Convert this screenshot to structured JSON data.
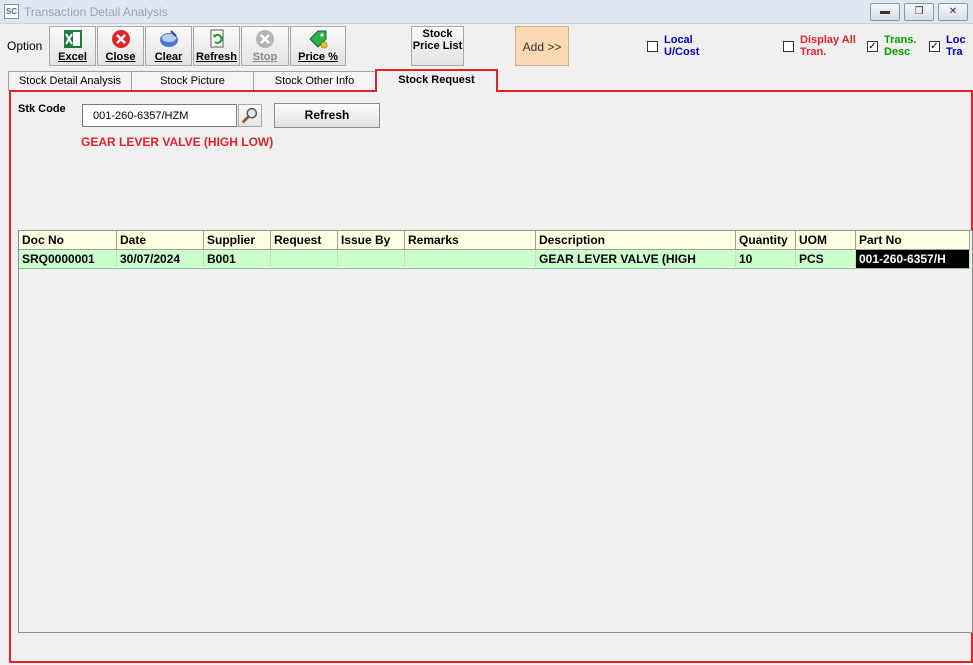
{
  "window": {
    "title": "Transaction Detail Analysis",
    "icon_text": "SC",
    "buttons": [
      "minimize-icon",
      "restore-icon",
      "close-icon"
    ]
  },
  "toolbar": {
    "option_label": "Option",
    "buttons": {
      "excel": "Excel",
      "close": "Close",
      "clear": "Clear",
      "refresh": "Refresh",
      "stop": "Stop",
      "price_pct": "Price %"
    },
    "stock_price_list": "Stock Price List",
    "add": "Add >>",
    "checkboxes": {
      "local_ucost": {
        "label_1": "Local",
        "label_2": "U/Cost",
        "checked": false,
        "color": "#0000c8"
      },
      "display_all": {
        "label_1": "Display All",
        "label_2": "Tran.",
        "checked": false,
        "color": "#e0242c"
      },
      "trans_desc": {
        "label_1": "Trans.",
        "label_2": "Desc",
        "checked": true,
        "color": "#00a000"
      },
      "loc_tra": {
        "label_1": "Loc",
        "label_2": "Tra",
        "checked": true,
        "color": "#0000c8"
      }
    }
  },
  "tabs": [
    {
      "label": "Stock Detail Analysis",
      "active": false
    },
    {
      "label": "Stock Picture",
      "active": false
    },
    {
      "label": "Stock Other Info",
      "active": false
    },
    {
      "label": "Stock Request",
      "active": true
    }
  ],
  "form": {
    "stk_code_label": "Stk Code",
    "stk_code_value": "001-260-6357/HZM",
    "refresh_label": "Refresh",
    "description": "GEAR LEVER VALVE (HIGH LOW)"
  },
  "grid": {
    "headers": [
      "Doc No",
      "Date",
      "Supplier",
      "Request",
      "Issue By",
      "Remarks",
      "Description",
      "Quantity",
      "UOM",
      "Part No"
    ],
    "rows": [
      [
        "SRQ0000001",
        "30/07/2024",
        "B001",
        "",
        "",
        "",
        "GEAR LEVER VALVE (HIGH",
        "10",
        "PCS",
        "001-260-6357/H"
      ]
    ]
  },
  "colors": {
    "accent_red": "#e0242c",
    "header_bg": "#ffffe1",
    "row_bg": "#ccffcc"
  }
}
